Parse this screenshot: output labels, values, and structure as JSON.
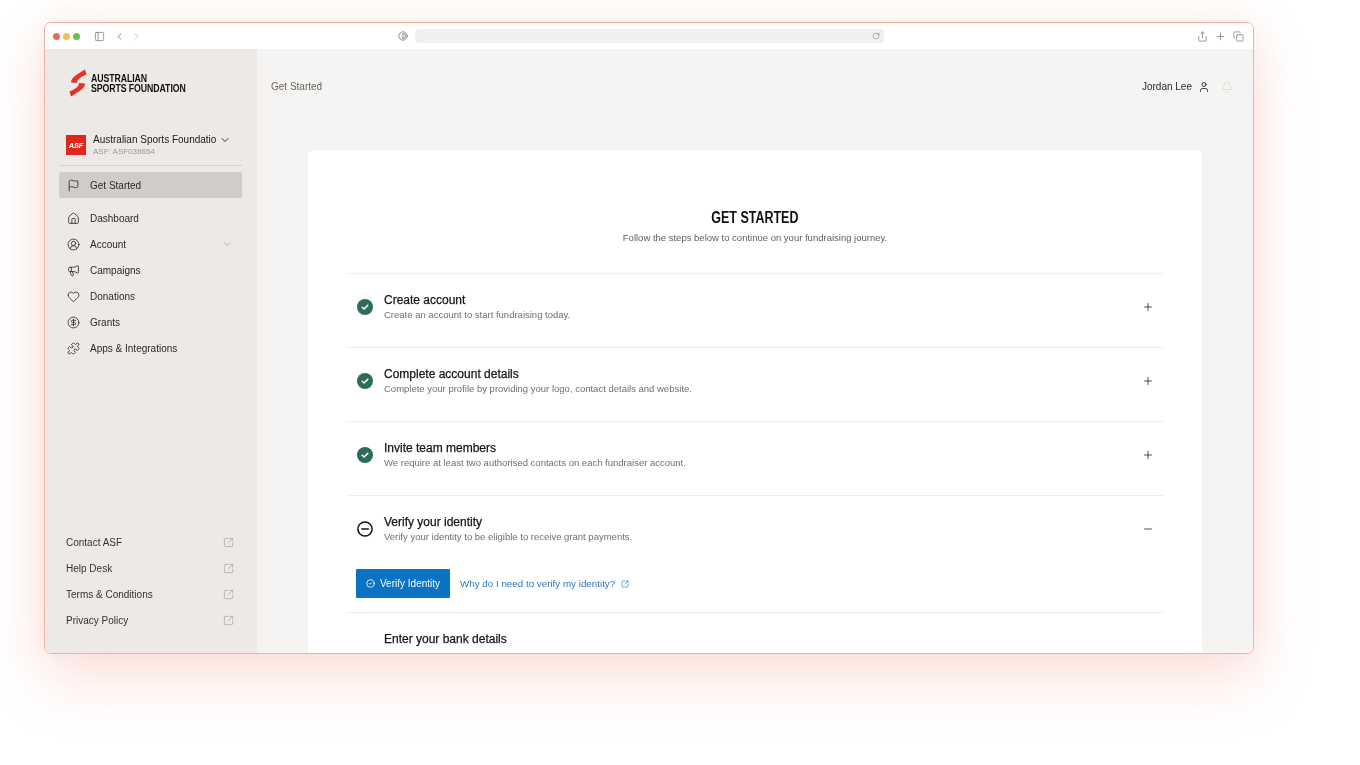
{
  "sidebar": {
    "logo": {
      "line_1": "AUSTRALIAN",
      "line_2": "SPORTS FOUNDATION"
    },
    "organization": {
      "badge": "ASF",
      "name": "Australian Sports Foundatio",
      "id": "ASF: ASF038654"
    },
    "nav": [
      {
        "label": "Get Started",
        "kind": "link",
        "selected": true
      },
      {
        "label": "Dashboard",
        "kind": "link",
        "selected": false
      },
      {
        "label": "Account",
        "kind": "group",
        "selected": false
      },
      {
        "label": "Campaigns",
        "kind": "link",
        "selected": false
      },
      {
        "label": "Donations",
        "kind": "link",
        "selected": false
      },
      {
        "label": "Grants",
        "kind": "link",
        "selected": false
      },
      {
        "label": "Apps & Integrations",
        "kind": "link",
        "selected": false
      }
    ],
    "footer_links": [
      {
        "label": "Contact ASF"
      },
      {
        "label": "Help Desk"
      },
      {
        "label": "Terms & Conditions"
      },
      {
        "label": "Privacy Policy"
      }
    ]
  },
  "header": {
    "breadcrumb": "Get Started",
    "user_name": "Jordan Lee"
  },
  "card": {
    "title": "GET STARTED",
    "subtitle": "Follow the steps below to continue on your fundraising journey.",
    "steps": [
      {
        "title": "Create account",
        "description": "Create an account to start fundraising today.",
        "completed": true,
        "expanded": false
      },
      {
        "title": "Complete account details",
        "description": "Complete your profile by providing your logo, contact details and website.",
        "completed": true,
        "expanded": false
      },
      {
        "title": "Invite team members",
        "description": "We require at least two authorised contacts on each fundraiser account.",
        "completed": true,
        "expanded": false
      },
      {
        "title": "Verify your identity",
        "description": "Verify your identity to be eligible to receive grant payments.",
        "completed": false,
        "expanded": true,
        "action_button": "Verify Identity",
        "help_link": "Why do I need to verify my identity?"
      },
      {
        "title": "Enter your bank details"
      }
    ]
  }
}
